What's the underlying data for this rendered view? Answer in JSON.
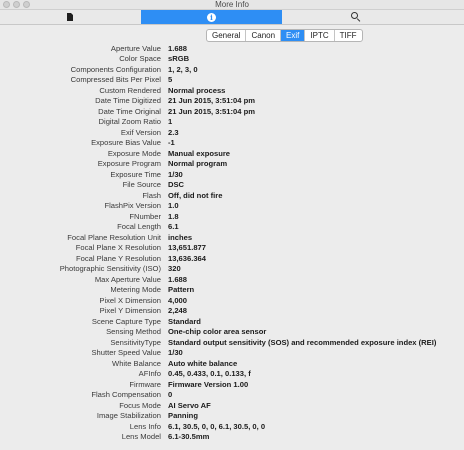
{
  "window": {
    "title": "More Info"
  },
  "toolbar": {
    "segments": [
      {
        "icon": "document-icon",
        "active": false
      },
      {
        "icon": "info-icon",
        "active": true
      },
      {
        "icon": "search-icon",
        "active": false
      }
    ],
    "info_glyph": "i"
  },
  "tabs": [
    {
      "label": "General",
      "selected": false
    },
    {
      "label": "Canon",
      "selected": false
    },
    {
      "label": "Exif",
      "selected": true
    },
    {
      "label": "IPTC",
      "selected": false
    },
    {
      "label": "TIFF",
      "selected": false
    }
  ],
  "properties": [
    {
      "key": "Aperture Value",
      "value": "1.688"
    },
    {
      "key": "Color Space",
      "value": "sRGB"
    },
    {
      "key": "Components Configuration",
      "value": "1, 2, 3, 0"
    },
    {
      "key": "Compressed Bits Per Pixel",
      "value": "5"
    },
    {
      "key": "Custom Rendered",
      "value": "Normal process"
    },
    {
      "key": "Date Time Digitized",
      "value": "21 Jun 2015, 3:51:04 pm"
    },
    {
      "key": "Date Time Original",
      "value": "21 Jun 2015, 3:51:04 pm"
    },
    {
      "key": "Digital Zoom Ratio",
      "value": "1"
    },
    {
      "key": "Exif Version",
      "value": "2.3"
    },
    {
      "key": "Exposure Bias Value",
      "value": "-1"
    },
    {
      "key": "Exposure Mode",
      "value": "Manual exposure"
    },
    {
      "key": "Exposure Program",
      "value": "Normal program"
    },
    {
      "key": "Exposure Time",
      "value": "1/30"
    },
    {
      "key": "File Source",
      "value": "DSC"
    },
    {
      "key": "Flash",
      "value": "Off, did not fire"
    },
    {
      "key": "FlashPix Version",
      "value": "1.0"
    },
    {
      "key": "FNumber",
      "value": "1.8"
    },
    {
      "key": "Focal Length",
      "value": "6.1"
    },
    {
      "key": "Focal Plane Resolution Unit",
      "value": "inches"
    },
    {
      "key": "Focal Plane X Resolution",
      "value": "13,651.877"
    },
    {
      "key": "Focal Plane Y Resolution",
      "value": "13,636.364"
    },
    {
      "key": "Photographic Sensitivity (ISO)",
      "value": "320"
    },
    {
      "key": "Max Aperture Value",
      "value": "1.688"
    },
    {
      "key": "Metering Mode",
      "value": "Pattern"
    },
    {
      "key": "Pixel X Dimension",
      "value": "4,000"
    },
    {
      "key": "Pixel Y Dimension",
      "value": "2,248"
    },
    {
      "key": "Scene Capture Type",
      "value": "Standard"
    },
    {
      "key": "Sensing Method",
      "value": "One-chip color area sensor"
    },
    {
      "key": "SensitivityType",
      "value": "Standard output sensitivity (SOS) and recommended exposure index (REI)"
    },
    {
      "key": "Shutter Speed Value",
      "value": "1/30"
    },
    {
      "key": "White Balance",
      "value": "Auto white balance"
    },
    {
      "key": "AFInfo",
      "value": "0.45, 0.433, 0.1, 0.133, f"
    },
    {
      "key": "Firmware",
      "value": "Firmware Version 1.00"
    },
    {
      "key": "Flash Compensation",
      "value": "0"
    },
    {
      "key": "Focus Mode",
      "value": "AI Servo AF"
    },
    {
      "key": "Image Stabilization",
      "value": "Panning"
    },
    {
      "key": "Lens Info",
      "value": "6.1, 30.5, 0, 0, 6.1, 30.5, 0, 0"
    },
    {
      "key": "Lens Model",
      "value": "6.1-30.5mm"
    }
  ]
}
